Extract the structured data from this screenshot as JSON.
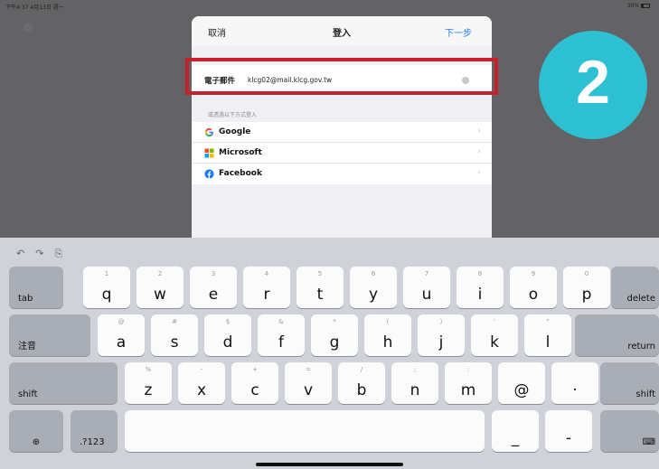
{
  "status": {
    "time": "下午4:37  4月13日 週一",
    "battery": "30%"
  },
  "sheet": {
    "cancel": "取消",
    "title": "登入",
    "next": "下一步",
    "email_label": "電子郵件",
    "email_value": "klcg02@mail.klcg.gov.tw",
    "hint": "或透過以下方式登入",
    "providers": [
      {
        "label": "Google",
        "icon": "google-icon"
      },
      {
        "label": "Microsoft",
        "icon": "microsoft-icon"
      },
      {
        "label": "Facebook",
        "icon": "facebook-icon"
      }
    ]
  },
  "badge": {
    "number": "2",
    "color": "#2dc0d3"
  },
  "highlight_color": "#c8202b",
  "keyboard": {
    "toolbar": [
      "undo-icon",
      "redo-icon",
      "paste-icon"
    ],
    "row1": [
      {
        "k": "q",
        "h": "1"
      },
      {
        "k": "w",
        "h": "2"
      },
      {
        "k": "e",
        "h": "3"
      },
      {
        "k": "r",
        "h": "4"
      },
      {
        "k": "t",
        "h": "5"
      },
      {
        "k": "y",
        "h": "6"
      },
      {
        "k": "u",
        "h": "7"
      },
      {
        "k": "i",
        "h": "8"
      },
      {
        "k": "o",
        "h": "9"
      },
      {
        "k": "p",
        "h": "0"
      }
    ],
    "row2": [
      {
        "k": "a",
        "h": "@"
      },
      {
        "k": "s",
        "h": "#"
      },
      {
        "k": "d",
        "h": "$"
      },
      {
        "k": "f",
        "h": "&"
      },
      {
        "k": "g",
        "h": "*"
      },
      {
        "k": "h",
        "h": "("
      },
      {
        "k": "j",
        "h": ")"
      },
      {
        "k": "k",
        "h": "'"
      },
      {
        "k": "l",
        "h": "\""
      }
    ],
    "row3": [
      {
        "k": "z",
        "h": "%"
      },
      {
        "k": "x",
        "h": "-"
      },
      {
        "k": "c",
        "h": "+"
      },
      {
        "k": "v",
        "h": "="
      },
      {
        "k": "b",
        "h": "/"
      },
      {
        "k": "n",
        "h": ";"
      },
      {
        "k": "m",
        "h": ":"
      },
      {
        "k": "@",
        "h": ""
      },
      {
        "k": "·",
        "h": ""
      }
    ],
    "tab": "tab",
    "delete": "delete",
    "zhuyin": "注音",
    "return": "return",
    "shift": "shift",
    "numbers": ".?123",
    "underscore": "_",
    "dash": "-"
  }
}
